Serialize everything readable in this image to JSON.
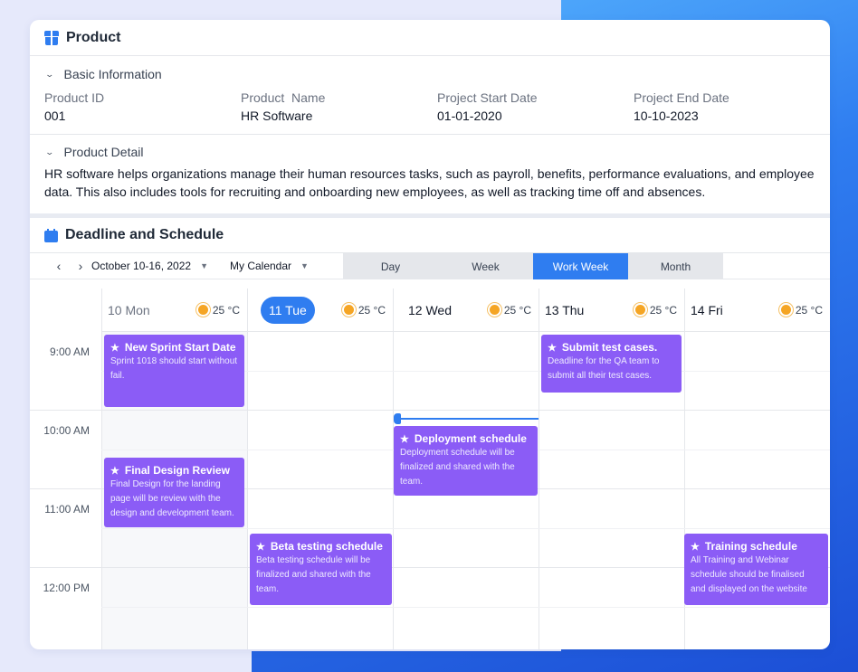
{
  "colors": {
    "accent": "#2f7df0",
    "event": "#8b5cf6",
    "background": "#e6e9fb"
  },
  "product": {
    "title": "Product",
    "icon": "package-icon",
    "basic_section": "Basic Information",
    "fields": [
      {
        "label": "Product ID",
        "value": "001"
      },
      {
        "label": "Product  Name",
        "value": "HR Software"
      },
      {
        "label": "Project Start Date",
        "value": "01-01-2020"
      },
      {
        "label": "Project End Date",
        "value": "10-10-2023"
      }
    ],
    "detail_section": "Product Detail",
    "detail_text": "HR software helps organizations manage their human resources tasks, such as payroll, benefits, performance evaluations, and employee data. This also includes tools for recruiting and onboarding new employees, as well as tracking time off and absences."
  },
  "schedule": {
    "title": "Deadline and Schedule",
    "icon": "calendar-icon",
    "date_range": "October 10-16, 2022",
    "calendar": "My Calendar",
    "views": [
      "Day",
      "Week",
      "Work Week",
      "Month"
    ],
    "active_view": "Work Week",
    "days": [
      {
        "label": "10 Mon",
        "temp": "25 °C"
      },
      {
        "label": "11 Tue",
        "temp": "25 °C"
      },
      {
        "label": "12 Wed",
        "temp": "25 °C"
      },
      {
        "label": "13 Thu",
        "temp": "25 °C"
      },
      {
        "label": "14 Fri",
        "temp": "25 °C"
      }
    ],
    "times": [
      "9:00 AM",
      "10:00 AM",
      "11:00 AM",
      "12:00 PM"
    ],
    "events": [
      {
        "title": "New Sprint Start Date",
        "desc": "Sprint 1018 should start without fail."
      },
      {
        "title": "Final Design Review",
        "desc": "Final Design for the landing page will be review with the design and development team."
      },
      {
        "title": "Beta testing schedule",
        "desc": "Beta testing schedule will be finalized and shared with the team."
      },
      {
        "title": "Deployment schedule",
        "desc": "Deployment schedule will be finalized and shared with the team."
      },
      {
        "title": "Submit test cases.",
        "desc": "Deadline for the QA team to submit all their test cases."
      },
      {
        "title": "Training schedule",
        "desc": "All Training and Webinar schedule should be finalised and displayed on the website"
      }
    ]
  }
}
